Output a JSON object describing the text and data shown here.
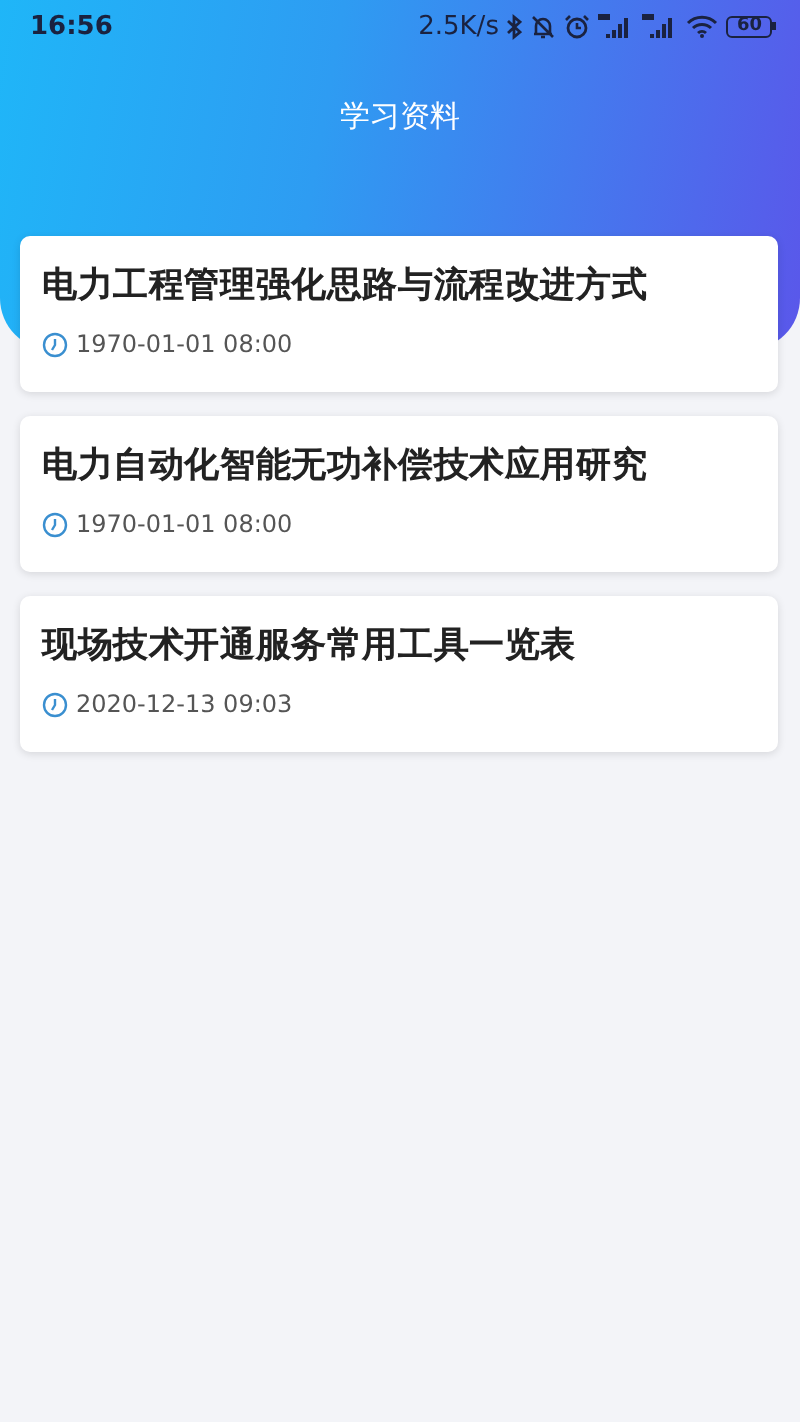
{
  "status_bar": {
    "time": "16:56",
    "net_speed": "2.5K/s",
    "battery": "60"
  },
  "header": {
    "title": "学习资料"
  },
  "articles": [
    {
      "title": "电力工程管理强化思路与流程改进方式",
      "date": "1970-01-01 08:00"
    },
    {
      "title": "电力自动化智能无功补偿技术应用研究",
      "date": "1970-01-01 08:00"
    },
    {
      "title": "现场技术开通服务常用工具一览表",
      "date": "2020-12-13 09:03"
    }
  ]
}
